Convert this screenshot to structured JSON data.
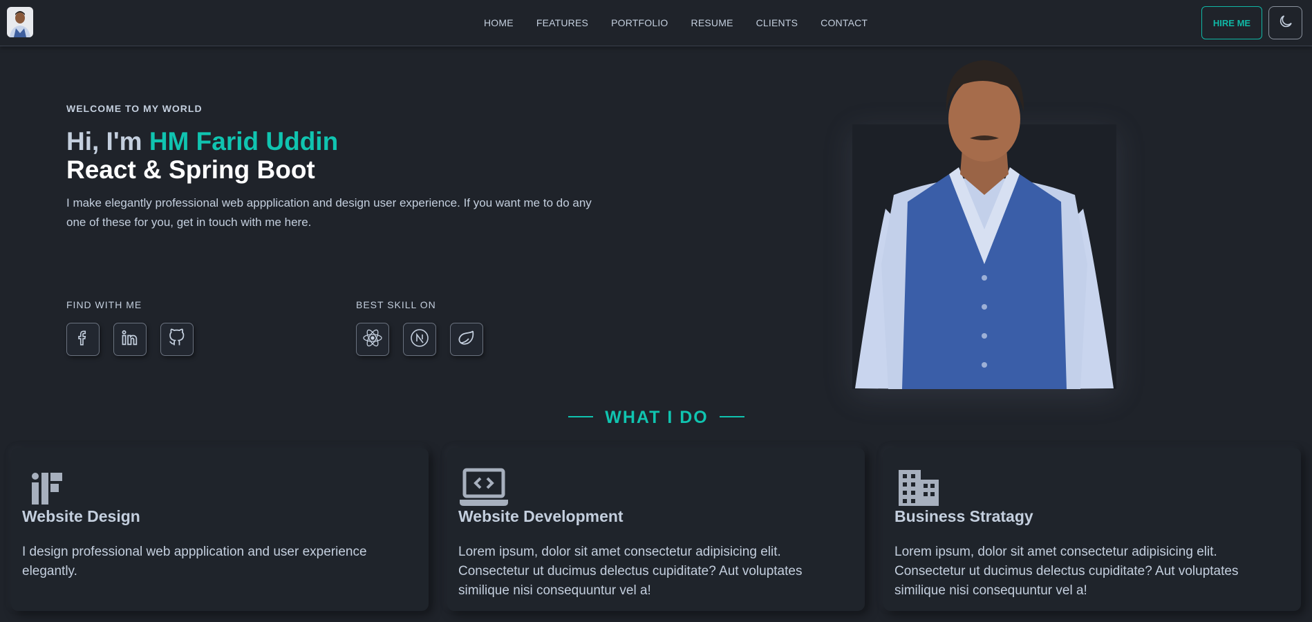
{
  "nav": {
    "links": [
      "HOME",
      "FEATURES",
      "PORTFOLIO",
      "RESUME",
      "CLIENTS",
      "CONTACT"
    ],
    "hire_label": "HIRE ME",
    "theme_icon": "moon-icon"
  },
  "hero": {
    "welcome": "WELCOME TO MY WORLD",
    "greeting": "Hi, I'm ",
    "name": "HM Farid Uddin",
    "role": "React & Spring Boot",
    "description": "I make elegantly professional web appplication and design user experience. If you want me to do any one of these for you, get in touch with me here.",
    "find_label": "FIND WITH ME",
    "skill_label": "BEST SKILL ON",
    "social_icons": [
      "facebook-icon",
      "linkedin-icon",
      "github-icon"
    ],
    "skill_icons": [
      "react-icon",
      "nextjs-icon",
      "spring-icon"
    ]
  },
  "what_i_do": {
    "title": "WHAT I DO",
    "cards": [
      {
        "title": "Website Design",
        "description": "I design professional web appplication and user experience elegantly.",
        "icon": "design-icon"
      },
      {
        "title": "Website Development",
        "description": "Lorem ipsum, dolor sit amet consectetur adipisicing elit. Consectetur ut ducimus delectus cupiditate? Aut voluptates similique nisi consequuntur vel a!",
        "icon": "laptop-code-icon"
      },
      {
        "title": "Business Stratagy",
        "description": "Lorem ipsum, dolor sit amet consectetur adipisicing elit. Consectetur ut ducimus delectus cupiditate? Aut voluptates similique nisi consequuntur vel a!",
        "icon": "building-icon"
      }
    ]
  },
  "colors": {
    "background": "#1f232a",
    "accent": "#10c4b0",
    "text": "#c4cfde"
  }
}
